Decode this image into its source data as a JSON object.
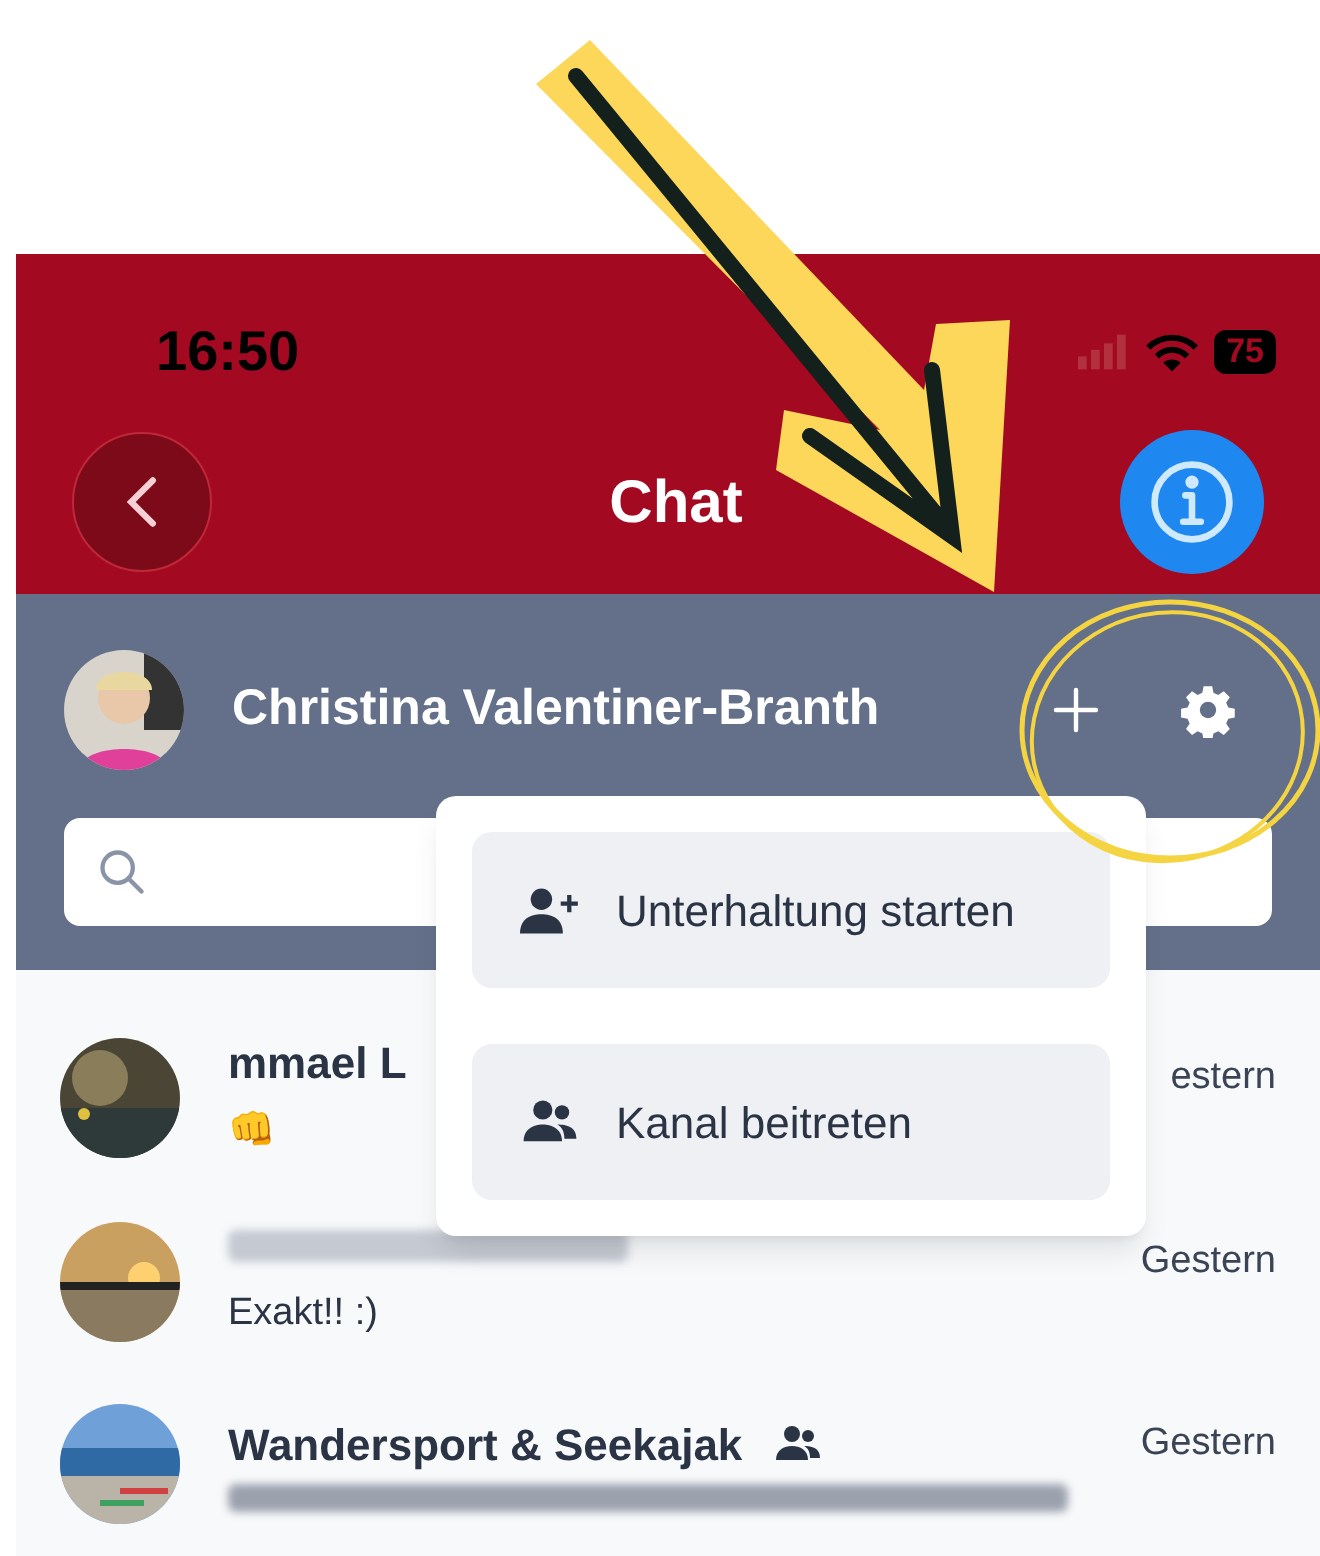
{
  "status_bar": {
    "time": "16:50",
    "battery": "75"
  },
  "nav": {
    "title": "Chat"
  },
  "user": {
    "name": "Christina Valentiner-Branth"
  },
  "menu": {
    "items": [
      {
        "label": "Unterhaltung starten",
        "kind": "person"
      },
      {
        "label": "Kanal beitreten",
        "kind": "group"
      }
    ]
  },
  "chats": [
    {
      "name": "mmael L",
      "preview": "👊",
      "time": "estern",
      "group": false,
      "kind": "picture"
    },
    {
      "preview": "Exakt!! :)",
      "time": "Gestern",
      "group": false,
      "kind": "picture"
    },
    {
      "name": "Wandersport & Seekajak",
      "time": "Gestern",
      "group": true,
      "kind": "picture"
    }
  ]
}
